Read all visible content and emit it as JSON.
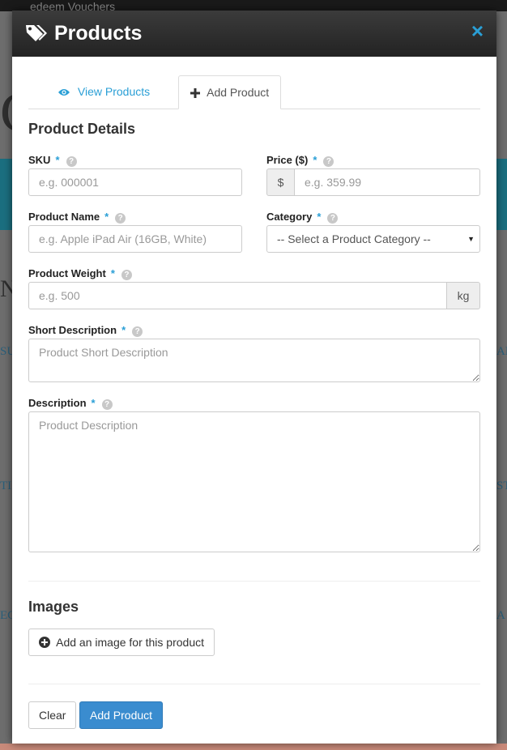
{
  "background": {
    "topbar_text": "edeem Vouchers"
  },
  "modal": {
    "title": "Products",
    "close_glyph": "×",
    "tabs": [
      {
        "label": "View Products",
        "icon": "eye-icon",
        "active": false
      },
      {
        "label": "Add Product",
        "icon": "plus-icon",
        "active": true
      }
    ],
    "section_details": "Product Details",
    "fields": {
      "sku": {
        "label": "SKU",
        "required": "*",
        "placeholder": "e.g. 000001",
        "value": ""
      },
      "price": {
        "label": "Price ($)",
        "required": "*",
        "addon": "$",
        "placeholder": "e.g. 359.99",
        "value": ""
      },
      "product_name": {
        "label": "Product Name",
        "required": "*",
        "placeholder": "e.g. Apple iPad Air (16GB, White)",
        "value": ""
      },
      "category": {
        "label": "Category",
        "required": "*",
        "selected": "-- Select a Product Category --"
      },
      "weight": {
        "label": "Product Weight",
        "required": "*",
        "placeholder": "e.g. 500",
        "addon": "kg",
        "value": ""
      },
      "short_description": {
        "label": "Short Description",
        "required": "*",
        "placeholder": "Product Short Description"
      },
      "description": {
        "label": "Description",
        "required": "*",
        "placeholder": "Product Description"
      }
    },
    "help_glyph": "?",
    "section_images": "Images",
    "add_image_label": "Add an image for this product",
    "footer": {
      "clear_label": "Clear",
      "submit_label": "Add Product"
    }
  },
  "colors": {
    "accent": "#2a9fd6",
    "primary_button": "#3a8ccf",
    "header_dark": "#2b2b2b"
  }
}
